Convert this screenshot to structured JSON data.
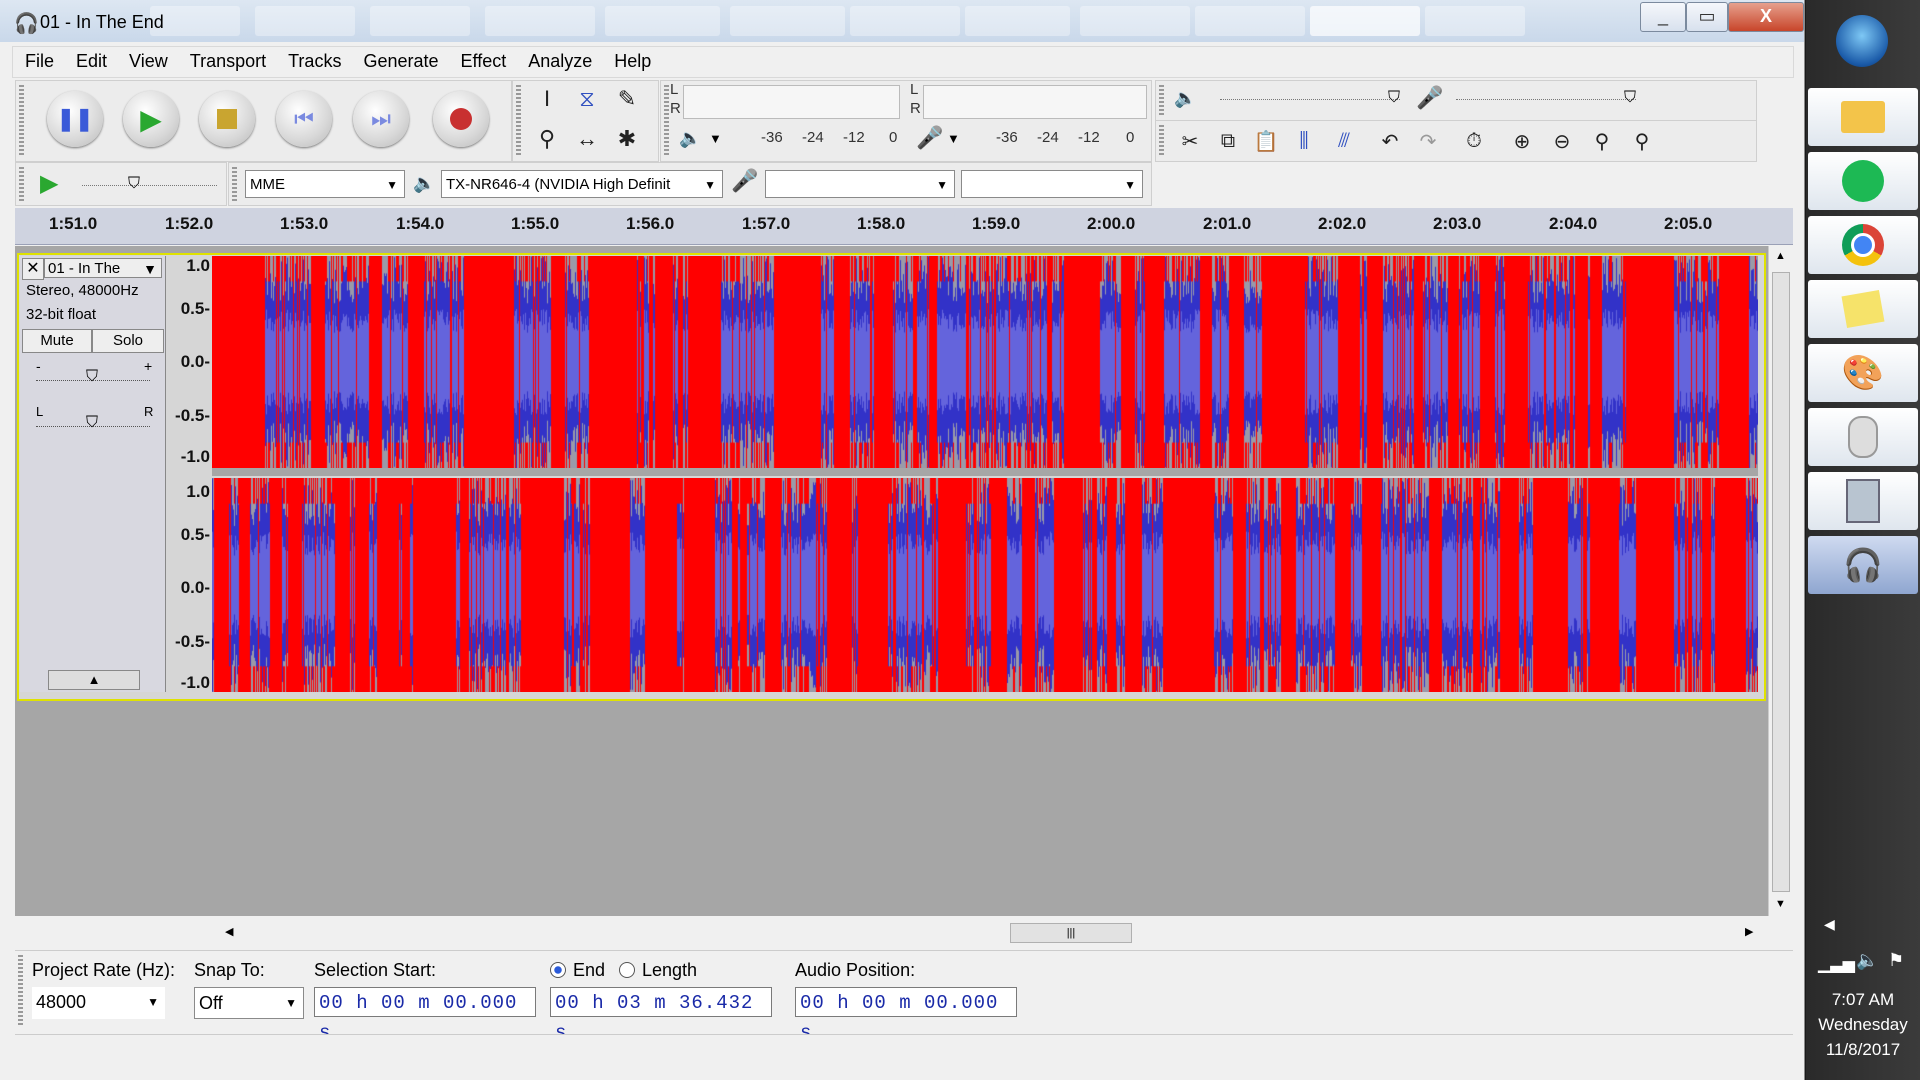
{
  "window": {
    "title": "01 - In The End",
    "controls": [
      "_",
      "▭",
      "X"
    ]
  },
  "menu": [
    "File",
    "Edit",
    "View",
    "Transport",
    "Tracks",
    "Generate",
    "Effect",
    "Analyze",
    "Help"
  ],
  "meters": {
    "playback": {
      "channels": [
        "L",
        "R"
      ]
    },
    "recording": {
      "channels": [
        "L",
        "R"
      ]
    },
    "scale_left": [
      "-36",
      "-24",
      "-12",
      "0"
    ],
    "scale_right": [
      "-36",
      "-24",
      "-12",
      "0"
    ]
  },
  "device": {
    "host": "MME",
    "output": "TX-NR646-4 (NVIDIA High Definit",
    "input": "",
    "channels": ""
  },
  "ruler": [
    "1:51.0",
    "1:52.0",
    "1:53.0",
    "1:54.0",
    "1:55.0",
    "1:56.0",
    "1:57.0",
    "1:58.0",
    "1:59.0",
    "2:00.0",
    "2:01.0",
    "2:02.0",
    "2:03.0",
    "2:04.0",
    "2:05.0"
  ],
  "track": {
    "name": "01 - In The",
    "info1": "Stereo, 48000Hz",
    "info2": "32-bit float",
    "mute": "Mute",
    "solo": "Solo",
    "gain_min": "-",
    "gain_max": "+",
    "pan_left": "L",
    "pan_right": "R",
    "scale": [
      "1.0",
      "0.5-",
      "0.0-",
      "-0.5-",
      "-1.0"
    ]
  },
  "selection": {
    "project_rate_label": "Project Rate (Hz):",
    "project_rate": "48000",
    "snap_label": "Snap To:",
    "snap": "Off",
    "start_label": "Selection Start:",
    "end_label": "End",
    "length_label": "Length",
    "end_selected": true,
    "start": "00 h 00 m 00.000 s",
    "end": "00 h 03 m 36.432 s",
    "position_label": "Audio Position:",
    "position": "00 h 00 m 00.000 s"
  },
  "clock": {
    "time": "7:07 AM",
    "day": "Wednesday",
    "date": "11/8/2017"
  },
  "colors": {
    "clipped": "#ff0000",
    "wave_blue": "#3232c8",
    "wave_light": "#6464dc",
    "selection_border": "#dfe200"
  },
  "taskbar_icons": [
    "start-orb-icon",
    "file-explorer-icon",
    "spotify-icon",
    "chrome-icon",
    "sticky-notes-icon",
    "paint-icon",
    "mouse-icon",
    "calculator-icon",
    "audacity-icon"
  ]
}
